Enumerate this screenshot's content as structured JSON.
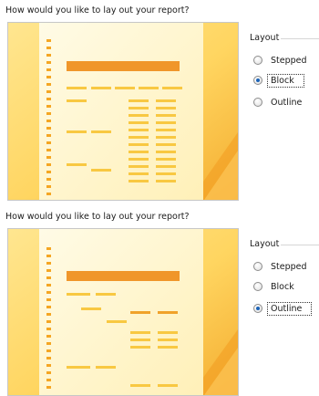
{
  "panels": [
    {
      "prompt": "How would you like to lay out your report?",
      "preview_layout": "block",
      "layout_group": {
        "label": "Layout",
        "options": [
          {
            "label": "Stepped",
            "selected": false
          },
          {
            "label": "Block",
            "selected": true
          },
          {
            "label": "Outline",
            "selected": false
          }
        ]
      }
    },
    {
      "prompt": "How would you like to lay out your report?",
      "preview_layout": "outline",
      "layout_group": {
        "label": "Layout",
        "options": [
          {
            "label": "Stepped",
            "selected": false
          },
          {
            "label": "Block",
            "selected": false
          },
          {
            "label": "Outline",
            "selected": true
          }
        ]
      }
    }
  ],
  "colors": {
    "preview_background": "#fff2bd",
    "preview_accent": "#f0962a",
    "preview_bar": "#f8c842",
    "preview_sidebar": "#f5a623",
    "radio_dot": "#1c63b7"
  }
}
